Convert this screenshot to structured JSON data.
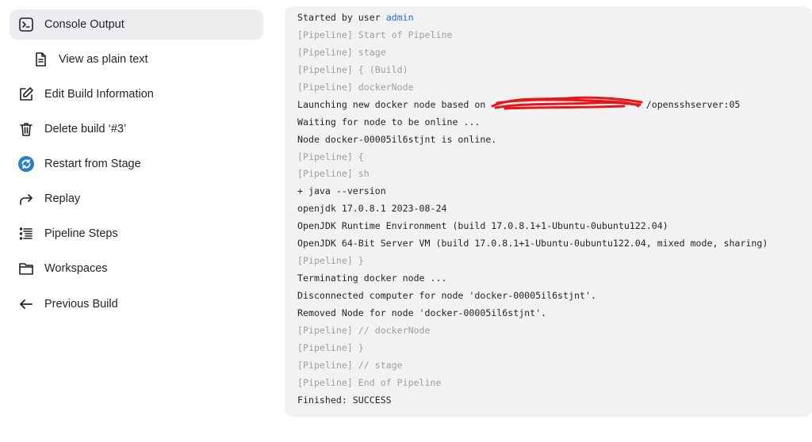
{
  "sidebar": {
    "items": [
      {
        "label": "Console Output",
        "icon": "terminal-icon"
      },
      {
        "label": "View as plain text",
        "icon": "document-icon"
      },
      {
        "label": "Edit Build Information",
        "icon": "edit-icon"
      },
      {
        "label": "Delete build ‘#3’",
        "icon": "trash-icon"
      },
      {
        "label": "Restart from Stage",
        "icon": "restart-icon"
      },
      {
        "label": "Replay",
        "icon": "replay-icon"
      },
      {
        "label": "Pipeline Steps",
        "icon": "list-icon"
      },
      {
        "label": "Workspaces",
        "icon": "folder-icon"
      },
      {
        "label": "Previous Build",
        "icon": "arrow-left-icon"
      }
    ]
  },
  "console": {
    "started_prefix": "Started by user ",
    "started_user": "admin",
    "lines": [
      "[Pipeline] Start of Pipeline",
      "[Pipeline] stage",
      "[Pipeline] { (Build)",
      "[Pipeline] dockerNode",
      "Launching new docker node based on                             /opensshserver:05",
      "Waiting for node to be online ...",
      "Node docker-00005il6stjnt is online.",
      "[Pipeline] {",
      "[Pipeline] sh",
      "+ java --version",
      "openjdk 17.0.8.1 2023-08-24",
      "OpenJDK Runtime Environment (build 17.0.8.1+1-Ubuntu-0ubuntu122.04)",
      "OpenJDK 64-Bit Server VM (build 17.0.8.1+1-Ubuntu-0ubuntu122.04, mixed mode, sharing)",
      "[Pipeline] }",
      "Terminating docker node ...",
      "Disconnected computer for node 'docker-00005il6stjnt'.",
      "Removed Node for node 'docker-00005il6stjnt'.",
      "[Pipeline] // dockerNode",
      "[Pipeline] }",
      "[Pipeline] // stage",
      "[Pipeline] End of Pipeline",
      "Finished: SUCCESS"
    ]
  },
  "colors": {
    "link": "#1f6fd0",
    "pipeline_text": "#9aa0a6",
    "redaction": "#e8161b"
  }
}
